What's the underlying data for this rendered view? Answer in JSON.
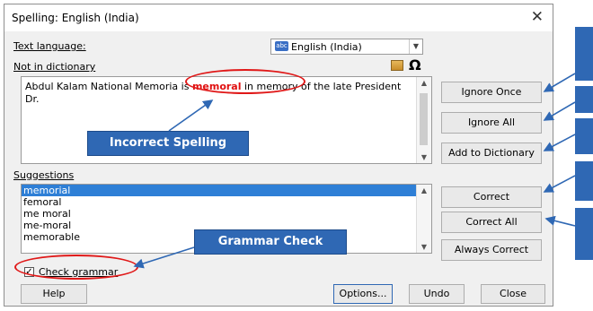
{
  "dialog": {
    "title": "Spelling: English (India)",
    "text_language_label": "Text language:",
    "language_value": "English (India)",
    "not_in_dictionary_label": "Not in dictionary",
    "sentence": {
      "before": "Abdul Kalam National Memori",
      "middle_a": "a is ",
      "misspelled": "memoral",
      "after": " in memory of the late President Dr."
    },
    "suggestions_label": "Suggestions",
    "suggestions": [
      "memorial",
      "femoral",
      "me moral",
      "me-moral",
      "memorable"
    ],
    "check_grammar_label": "Check grammar",
    "buttons": {
      "ignore_once": "Ignore Once",
      "ignore_all": "Ignore All",
      "add_to_dictionary": "Add to Dictionary",
      "correct": "Correct",
      "correct_all": "Correct All",
      "always_correct": "Always Correct",
      "help": "Help",
      "options": "Options...",
      "undo": "Undo",
      "close": "Close"
    }
  },
  "callouts": {
    "incorrect_spelling": "Incorrect Spelling",
    "grammar_check": "Grammar Check"
  },
  "icons": [
    "close-icon",
    "dropdown-arrow-icon",
    "language-flag-icon",
    "autocorrect-icon",
    "special-character-icon",
    "scroll-up-icon",
    "scroll-down-icon",
    "checkmark-icon"
  ],
  "colors": {
    "accent": "#2f68b4",
    "error": "#e01010",
    "selection": "#2e7fd6"
  }
}
